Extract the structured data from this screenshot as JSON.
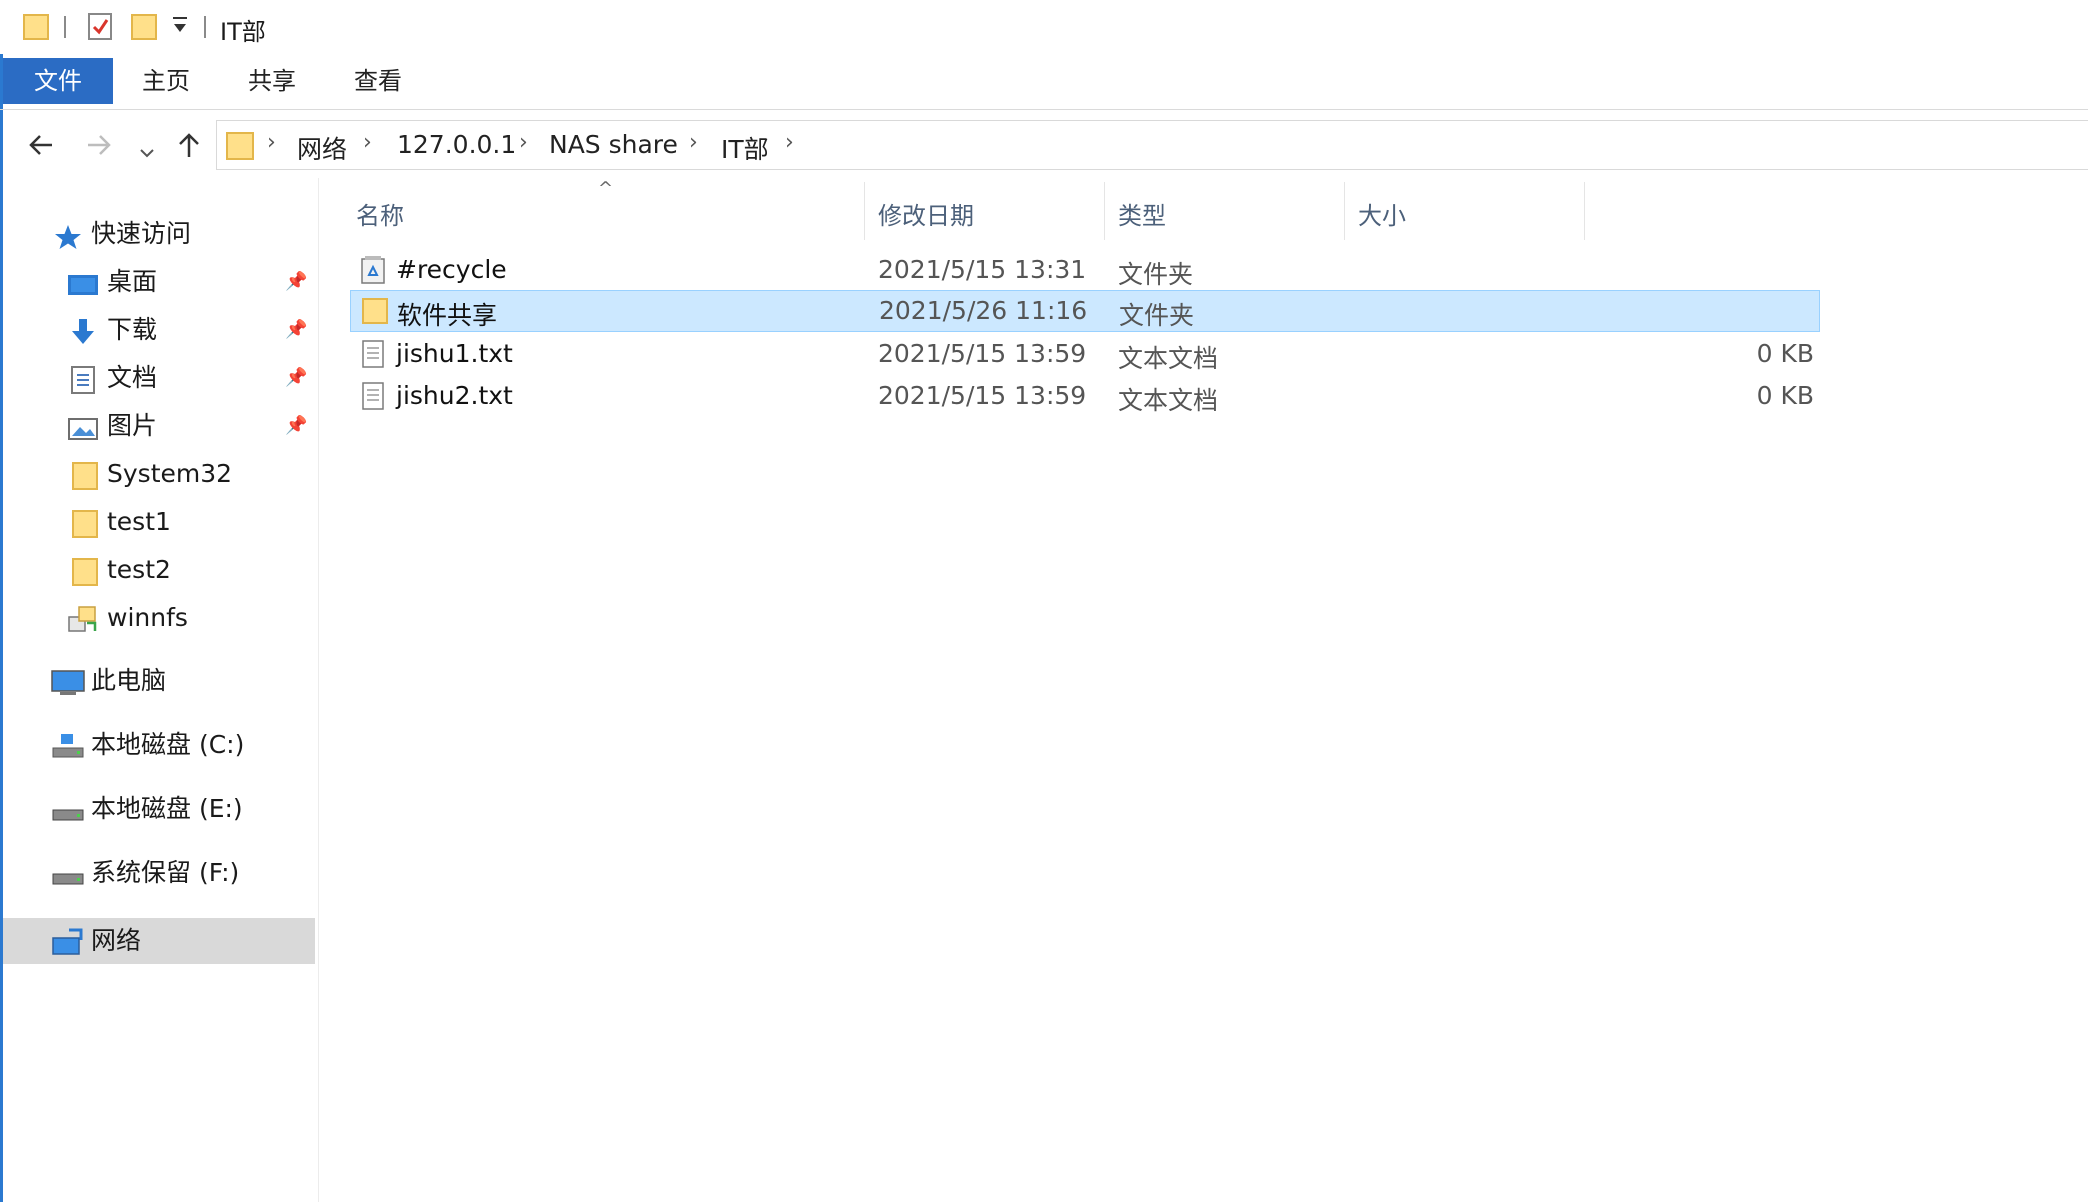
{
  "window": {
    "title": "IT部"
  },
  "ribbon": {
    "tabs": [
      {
        "label": "文件"
      },
      {
        "label": "主页"
      },
      {
        "label": "共享"
      },
      {
        "label": "查看"
      }
    ]
  },
  "address": {
    "segments": [
      "网络",
      "127.0.0.1",
      "NAS share",
      "IT部"
    ]
  },
  "sidebar": {
    "quick_access": "快速访问",
    "pinned": [
      {
        "label": "桌面",
        "icon": "desktop-icon"
      },
      {
        "label": "下载",
        "icon": "download-icon"
      },
      {
        "label": "文档",
        "icon": "documents-icon"
      },
      {
        "label": "图片",
        "icon": "pictures-icon"
      }
    ],
    "folders": [
      {
        "label": "System32",
        "icon": "folder-icon"
      },
      {
        "label": "test1",
        "icon": "folder-icon"
      },
      {
        "label": "test2",
        "icon": "folder-icon"
      },
      {
        "label": "winnfs",
        "icon": "network-folder-icon"
      }
    ],
    "this_pc": "此电脑",
    "drives": [
      {
        "label": "本地磁盘 (C:)"
      },
      {
        "label": "本地磁盘 (E:)"
      },
      {
        "label": "系统保留 (F:)"
      }
    ],
    "network": "网络"
  },
  "filelist": {
    "headers": {
      "name": "名称",
      "date": "修改日期",
      "type": "类型",
      "size": "大小"
    },
    "rows": [
      {
        "name": "#recycle",
        "date": "2021/5/15 13:31",
        "type": "文件夹",
        "size": "",
        "icon": "recycle-folder-icon"
      },
      {
        "name": "软件共享",
        "date": "2021/5/26 11:16",
        "type": "文件夹",
        "size": "",
        "icon": "folder-icon",
        "selected": true
      },
      {
        "name": "jishu1.txt",
        "date": "2021/5/15 13:59",
        "type": "文本文档",
        "size": "0 KB",
        "icon": "text-file-icon"
      },
      {
        "name": "jishu2.txt",
        "date": "2021/5/15 13:59",
        "type": "文本文档",
        "size": "0 KB",
        "icon": "text-file-icon"
      }
    ]
  },
  "colors": {
    "accent": "#2b6cc4",
    "selection": "#cce8ff",
    "nav_selected": "#d9d9d9"
  }
}
